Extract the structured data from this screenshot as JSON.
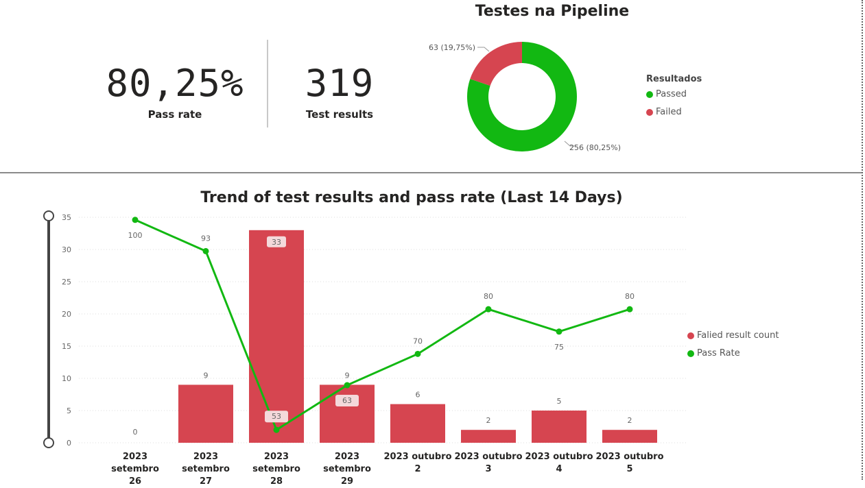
{
  "kpis": {
    "pass_rate_value": "80,25%",
    "pass_rate_label": "Pass rate",
    "test_results_value": "319",
    "test_results_label": "Test results"
  },
  "colors": {
    "passed": "#12b812",
    "failed": "#d64550",
    "text": "#252423"
  },
  "chart_data": [
    {
      "type": "pie",
      "title": "Testes na Pipeline",
      "legend_title": "Resultados",
      "legend_position": "right",
      "categories": [
        "Passed",
        "Failed"
      ],
      "values": [
        256,
        63
      ],
      "data_labels": [
        "256 (80,25%)",
        "63 (19,75%)"
      ]
    },
    {
      "type": "bar",
      "title": "Trend of test results and pass rate (Last 14 Days)",
      "legend_position": "right",
      "categories": [
        [
          "2023 setembro",
          "26"
        ],
        [
          "2023 setembro",
          "27"
        ],
        [
          "2023 setembro",
          "28"
        ],
        [
          "2023 setembro",
          "29"
        ],
        [
          "2023 outubro",
          "2"
        ],
        [
          "2023 outubro",
          "3"
        ],
        [
          "2023 outubro",
          "4"
        ],
        [
          "2023 outubro",
          "5"
        ]
      ],
      "ylim": [
        0,
        35
      ],
      "yticks": [
        "0",
        "5",
        "10",
        "15",
        "20",
        "25",
        "30",
        "35"
      ],
      "grid": true,
      "series": [
        {
          "name": "Falied result count",
          "type": "bar",
          "values": [
            0,
            9,
            33,
            9,
            6,
            2,
            5,
            2
          ]
        },
        {
          "name": "Pass Rate",
          "type": "line",
          "values": [
            100,
            93,
            53,
            63,
            70,
            80,
            75,
            80
          ]
        }
      ]
    }
  ]
}
